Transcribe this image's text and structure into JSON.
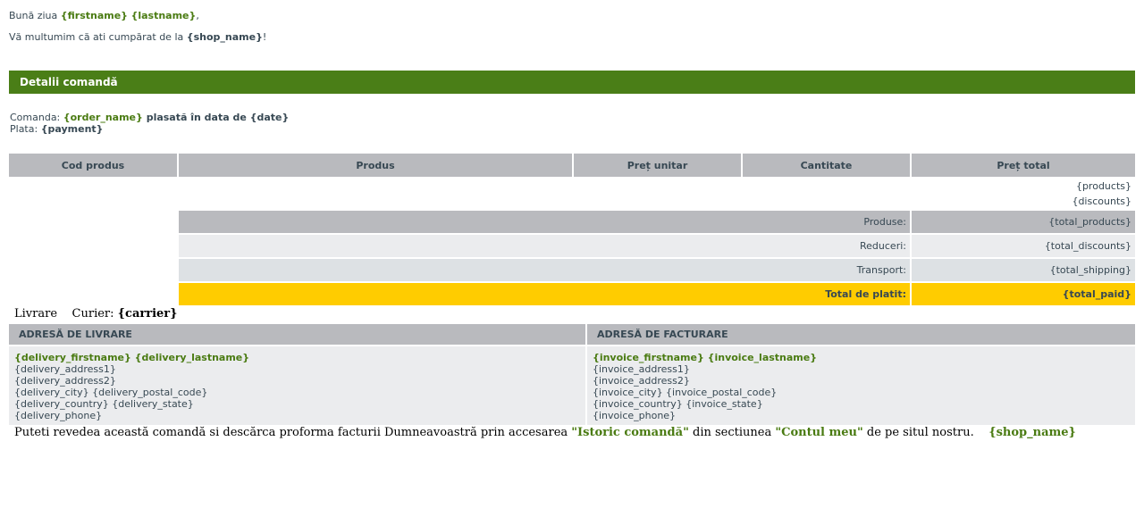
{
  "greeting": {
    "prefix": "Bună ziua ",
    "firstname": "{firstname}",
    "lastname": "{lastname}",
    "suffix": ","
  },
  "thanks": {
    "prefix": "Vă multumim că ati cumpărat de la ",
    "shop": "{shop_name}",
    "suffix": "!"
  },
  "section_title": "Detalii comandă",
  "order": {
    "label": "Comanda: ",
    "name": "{order_name}",
    "placed": " plasată în data de {date}",
    "payment_label": "Plata: ",
    "payment": "{payment}"
  },
  "table": {
    "headers": [
      "Cod produs",
      "Produs",
      "Preț unitar",
      "Cantitate",
      "Preț total"
    ],
    "items": [
      "{products}",
      "{discounts}"
    ],
    "totals": [
      {
        "label": "Produse:",
        "value": "{total_products}"
      },
      {
        "label": "Reduceri:",
        "value": "{total_discounts}"
      },
      {
        "label": "Transport:",
        "value": "{total_shipping}"
      },
      {
        "label": "Total de platit:",
        "value": "{total_paid}"
      }
    ]
  },
  "delivery": {
    "label": "Livrare",
    "courier_label": "Curier: ",
    "carrier": "{carrier}"
  },
  "addresses": {
    "delivery_title": "ADRESĂ DE LIVRARE",
    "invoice_title": "ADRESĂ DE FACTURARE",
    "delivery_name": "{delivery_firstname} {delivery_lastname}",
    "delivery_lines": [
      "{delivery_address1}",
      "{delivery_address2}",
      "{delivery_city} {delivery_postal_code}",
      "{delivery_country} {delivery_state}",
      "{delivery_phone}"
    ],
    "invoice_name": "{invoice_firstname} {invoice_lastname}",
    "invoice_lines": [
      "{invoice_address1}",
      "{invoice_address2}",
      "{invoice_city} {invoice_postal_code}",
      "{invoice_country} {invoice_state}",
      "{invoice_phone}"
    ]
  },
  "footer": {
    "text1": "Puteti revedea această comandă si descărca proforma facturii Dumneavoastră prin accesarea ",
    "link1": "\"Istoric comandă\"",
    "text2": " din sectiunea ",
    "link2": "\"Contul meu\"",
    "text3": " de pe situl nostru.",
    "shop": "{shop_name}"
  },
  "colors": {
    "header_green": "#4a7e17",
    "gray": "#b9babe",
    "total_yellow": "#ffcc00"
  }
}
